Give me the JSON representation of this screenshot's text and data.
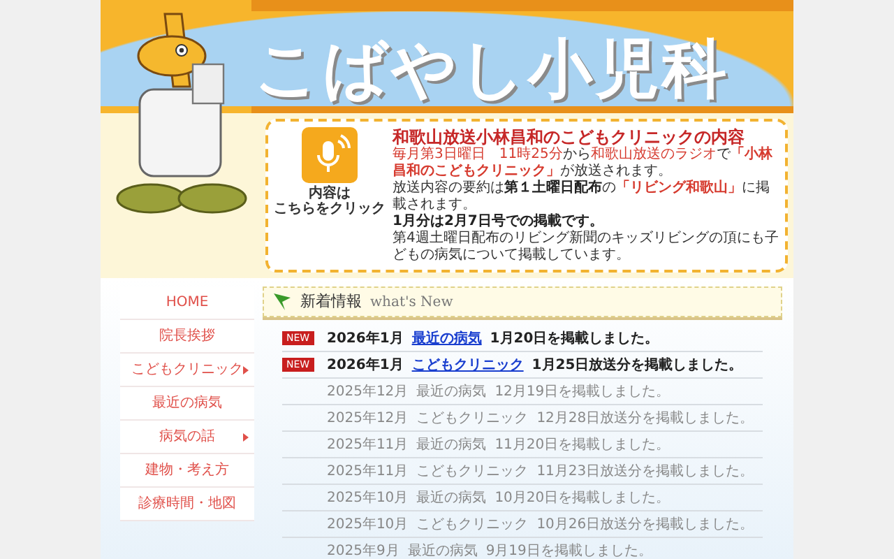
{
  "site_title": "こばやし小児科",
  "radio_box": {
    "button_caption": [
      "内容は",
      "こちらをクリック"
    ],
    "title": "和歌山放送小林昌和のこどもクリニックの内容",
    "lines": [
      {
        "segments": [
          {
            "kind": "red",
            "text": "毎月第3日曜日　11時25分"
          },
          {
            "kind": "plain",
            "text": "から"
          },
          {
            "kind": "red",
            "text": "和歌山放送のラジオ"
          },
          {
            "kind": "plain",
            "text": "で"
          },
          {
            "kind": "redbold",
            "text": "「小林昌和のこどもクリニック」"
          },
          {
            "kind": "plain",
            "text": "が放送されます。"
          }
        ]
      },
      {
        "segments": [
          {
            "kind": "plain",
            "text": "放送内容の要約は"
          },
          {
            "kind": "bold",
            "text": "第１土曜日配布"
          },
          {
            "kind": "plain",
            "text": "の"
          },
          {
            "kind": "redbold",
            "text": "「リビング和歌山」"
          },
          {
            "kind": "plain",
            "text": "に掲載されます。"
          }
        ]
      },
      {
        "segments": [
          {
            "kind": "bold",
            "text": "1月分は2月7日号での掲載です。"
          }
        ]
      },
      {
        "segments": [
          {
            "kind": "plain",
            "text": "第4週土曜日配布のリビング新聞のキッズリビングの頂にも子どもの病気について掲載しています。"
          }
        ]
      }
    ]
  },
  "sidebar": {
    "items": [
      {
        "label": "HOME",
        "has_submenu": false
      },
      {
        "label": "院長挨拶",
        "has_submenu": false
      },
      {
        "label": "こどもクリニック",
        "has_submenu": true
      },
      {
        "label": "最近の病気",
        "has_submenu": false
      },
      {
        "label": "病気の話",
        "has_submenu": true
      },
      {
        "label": "建物・考え方",
        "has_submenu": false
      },
      {
        "label": "診療時間・地図",
        "has_submenu": false
      }
    ]
  },
  "news": {
    "title": "新着情報",
    "subtitle": "what's New",
    "rows": [
      {
        "new": true,
        "badge": "NEW",
        "date": "2026年1月",
        "link": "最近の病気",
        "text": "1月20日を掲載しました。"
      },
      {
        "new": true,
        "badge": "NEW",
        "date": "2026年1月",
        "link": "こどもクリニック",
        "text": "1月25日放送分を掲載しました。"
      },
      {
        "new": false,
        "date": "2025年12月",
        "link": "最近の病気",
        "text": "12月19日を掲載しました。"
      },
      {
        "new": false,
        "date": "2025年12月",
        "link": "こどもクリニック",
        "text": "12月28日放送分を掲載しました。"
      },
      {
        "new": false,
        "date": "2025年11月",
        "link": "最近の病気",
        "text": "11月20日を掲載しました。"
      },
      {
        "new": false,
        "date": "2025年11月",
        "link": "こどもクリニック",
        "text": "11月23日放送分を掲載しました。"
      },
      {
        "new": false,
        "date": "2025年10月",
        "link": "最近の病気",
        "text": "10月20日を掲載しました。"
      },
      {
        "new": false,
        "date": "2025年10月",
        "link": "こどもクリニック",
        "text": "10月26日放送分を掲載しました。"
      },
      {
        "new": false,
        "date": "2025年9月",
        "link": "最近の病気",
        "text": "9月19日を掲載しました。"
      }
    ]
  }
}
